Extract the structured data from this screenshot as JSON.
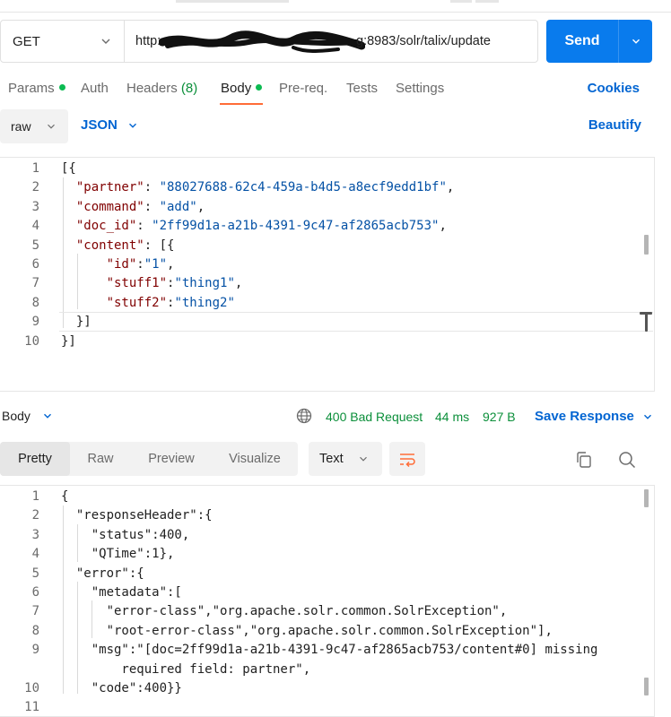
{
  "request": {
    "method": "GET",
    "url_prefix": "http:",
    "url_suffix": "g:8983/solr/talix/update",
    "send_label": "Send"
  },
  "tabs": [
    {
      "label": "Params",
      "dot": true
    },
    {
      "label": "Auth"
    },
    {
      "label": "Headers",
      "count": "(8)"
    },
    {
      "label": "Body",
      "dot": true,
      "active": true
    },
    {
      "label": "Pre-req."
    },
    {
      "label": "Tests"
    },
    {
      "label": "Settings"
    }
  ],
  "cookies_label": "Cookies",
  "body_type": "raw",
  "body_format": "JSON",
  "beautify_label": "Beautify",
  "request_body_lines": [
    "[{",
    "  \"partner\": \"88027688-62c4-459a-b4d5-a8ecf9edd1bf\",",
    "  \"command\": \"add\",",
    "  \"doc_id\": \"2ff99d1a-a21b-4391-9c47-af2865acb753\",",
    "  \"content\": [{",
    "      \"id\":\"1\",",
    "      \"stuff1\":\"thing1\",",
    "      \"stuff2\":\"thing2\"",
    "  }]",
    "}]"
  ],
  "response": {
    "section_label": "Body",
    "status": "400 Bad Request",
    "time": "44 ms",
    "size": "927 B",
    "save_label": "Save Response",
    "view_tabs": [
      "Pretty",
      "Raw",
      "Preview",
      "Visualize"
    ],
    "active_view": "Pretty",
    "format": "Text"
  },
  "response_body_lines": [
    {
      "n": "1",
      "t": "{"
    },
    {
      "n": "2",
      "t": "  \"responseHeader\":{"
    },
    {
      "n": "3",
      "t": "    \"status\":400,"
    },
    {
      "n": "4",
      "t": "    \"QTime\":1},"
    },
    {
      "n": "5",
      "t": "  \"error\":{"
    },
    {
      "n": "6",
      "t": "    \"metadata\":["
    },
    {
      "n": "7",
      "t": "      \"error-class\",\"org.apache.solr.common.SolrException\","
    },
    {
      "n": "8",
      "t": "      \"root-error-class\",\"org.apache.solr.common.SolrException\"],"
    },
    {
      "n": "9",
      "t": "    \"msg\":\"[doc=2ff99d1a-a21b-4391-9c47-af2865acb753/content#0] missing"
    },
    {
      "n": "",
      "t": "        required field: partner\","
    },
    {
      "n": "10",
      "t": "    \"code\":400}}"
    },
    {
      "n": "11",
      "t": ""
    }
  ],
  "colors": {
    "accent": "#097bed",
    "link": "#0265d2",
    "success_text": "#0b8f3a",
    "tab_indicator": "#ff6c37",
    "json_key": "#800000",
    "json_string": "#0451a5"
  }
}
